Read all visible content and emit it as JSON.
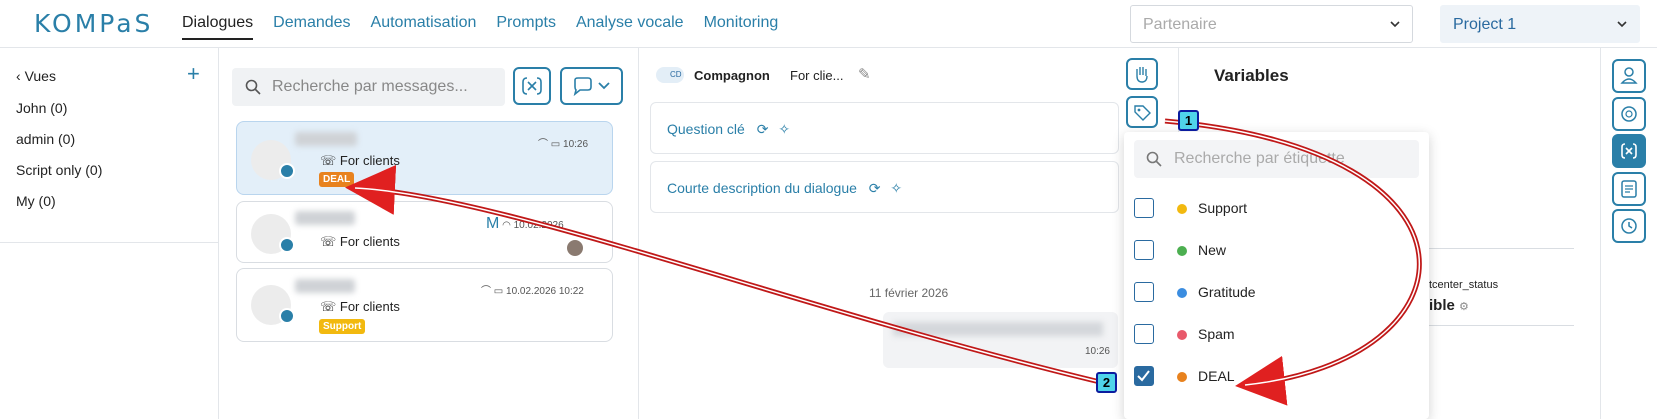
{
  "app": {
    "logo": "KOMPaS"
  },
  "nav": {
    "items": [
      "Dialogues",
      "Demandes",
      "Automatisation",
      "Prompts",
      "Analyse vocale",
      "Monitoring"
    ]
  },
  "header": {
    "partner_placeholder": "Partenaire",
    "project": "Project 1"
  },
  "views": {
    "title": "Vues",
    "items": [
      "John (0)",
      "admin (0)",
      "Script only (0)",
      "My (0)"
    ]
  },
  "search": {
    "placeholder": "Recherche par messages..."
  },
  "conversations": [
    {
      "channel": "For clients",
      "time": "10:26",
      "tag": "DEAL",
      "tag_color": "#e8821e"
    },
    {
      "channel": "For clients",
      "time": "10.02.2026",
      "tag": "",
      "tag_color": ""
    },
    {
      "channel": "For clients",
      "time": "10.02.2026 10:22",
      "tag": "Support",
      "tag_color": "#f2b90f"
    }
  ],
  "chat": {
    "companion_label": "Compagnon",
    "companion_badge": "CD",
    "for_clients": "For clie...",
    "key_question": "Question clé",
    "short_desc": "Courte description du dialogue",
    "date_separator": "11 février 2026",
    "bubble_time": "10:26"
  },
  "variables": {
    "title": "Variables",
    "var_name": "tcenter_status",
    "var_value": "ible"
  },
  "tag_dropdown": {
    "placeholder": "Recherche par étiquette",
    "items": [
      {
        "label": "Support",
        "color": "#f2b90f",
        "checked": false
      },
      {
        "label": "New",
        "color": "#4caf50",
        "checked": false
      },
      {
        "label": "Gratitude",
        "color": "#3b8de0",
        "checked": false
      },
      {
        "label": "Spam",
        "color": "#e8596b",
        "checked": false
      },
      {
        "label": "DEAL",
        "color": "#e8821e",
        "checked": true
      }
    ]
  },
  "annotations": {
    "marker1": "1",
    "marker2": "2"
  }
}
